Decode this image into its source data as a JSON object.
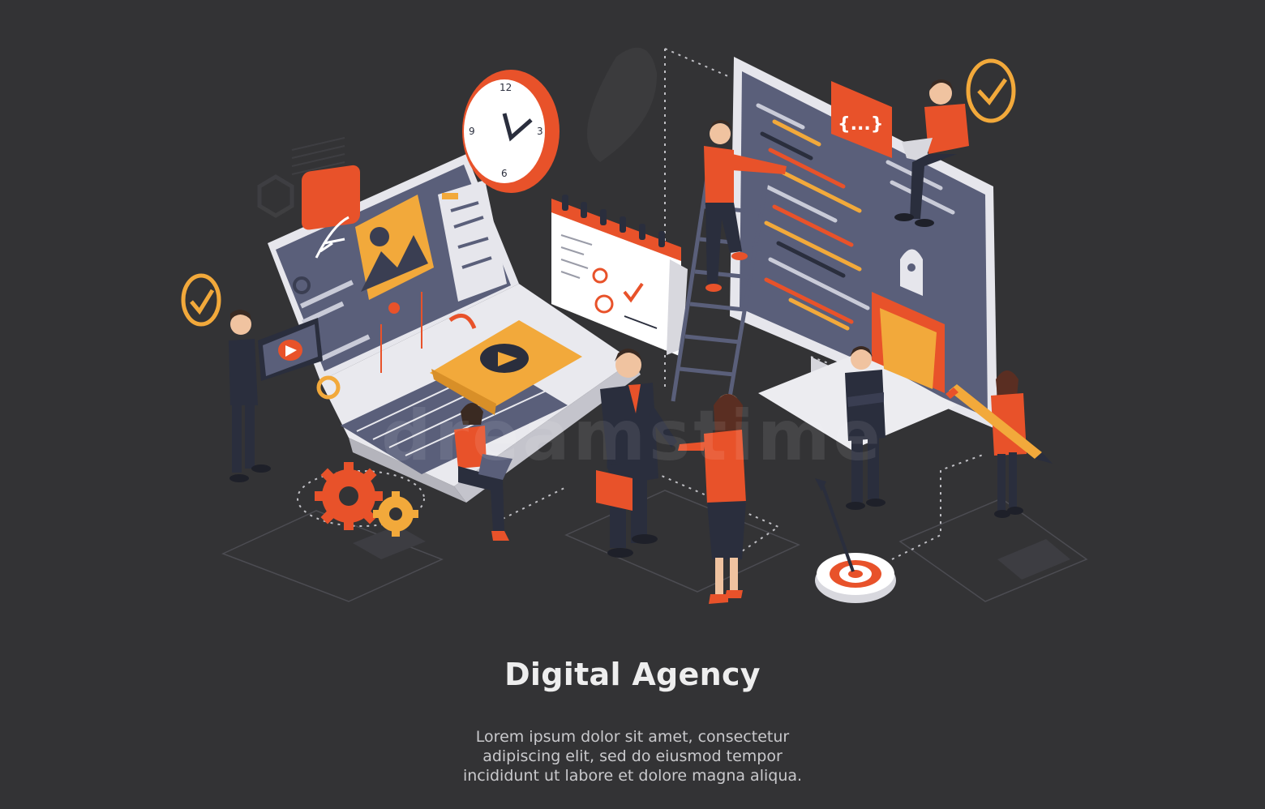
{
  "scene": {
    "headline": "Digital Agency",
    "body_lines": [
      "Lorem ipsum dolor sit amet, consectetur",
      "adipiscing elit, sed do eiusmod tempor",
      "incididunt ut labore et dolore magna aliqua."
    ],
    "watermark": "dreamstime",
    "code_badge": "{...}"
  },
  "colors": {
    "background": "#333335",
    "accent_orange": "#e8522a",
    "accent_yellow": "#f2a93b",
    "screen_slate": "#5a5f7a",
    "device_white": "#e9e9ee",
    "suit_navy": "#2a2e3d"
  },
  "icons": [
    "clock-icon",
    "calendar-icon",
    "code-icon",
    "rocket-icon",
    "pen-tool-icon",
    "gear-icon",
    "target-icon",
    "arrow-icon",
    "check-icon",
    "play-icon",
    "image-icon",
    "pencil-icon",
    "ladder-icon",
    "briefcase-icon"
  ]
}
